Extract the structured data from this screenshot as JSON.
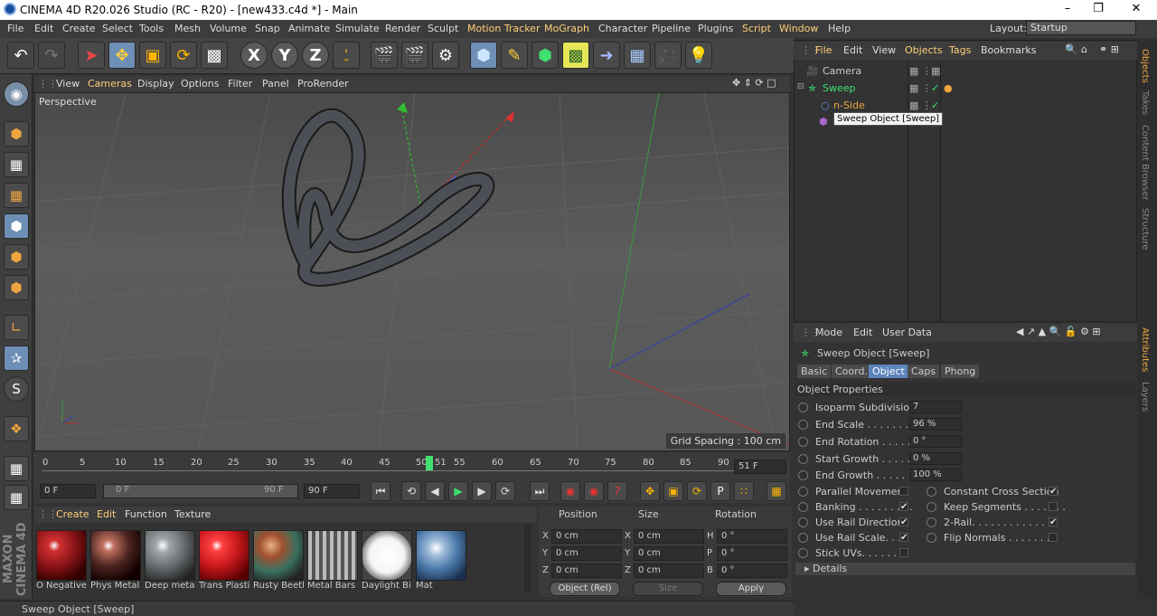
{
  "window": {
    "title": "CINEMA 4D R20.026 Studio (RC - R20) - [new433.c4d *] - Main"
  },
  "menu": [
    "File",
    "Edit",
    "Create",
    "Select",
    "Tools",
    "Mesh",
    "Volume",
    "Snap",
    "Animate",
    "Simulate",
    "Render",
    "Sculpt",
    "Motion Tracker",
    "MoGraph",
    "Character",
    "Pipeline",
    "Plugins",
    "Script",
    "Window",
    "Help"
  ],
  "layout": {
    "label": "Layout:",
    "value": "Startup"
  },
  "toolbar_glyphs": {
    "x": "X",
    "y": "Y",
    "z": "Z"
  },
  "viewport": {
    "menu": [
      "View",
      "Cameras",
      "Display",
      "Options",
      "Filter",
      "Panel",
      "ProRender"
    ],
    "label": "Perspective",
    "grid_spacing": "Grid Spacing : 100 cm"
  },
  "timeline": {
    "ticks": [
      "0",
      "5",
      "10",
      "15",
      "20",
      "25",
      "30",
      "35",
      "40",
      "45",
      "50",
      "51",
      "55",
      "60",
      "65",
      "70",
      "75",
      "80",
      "85",
      "90"
    ],
    "current_frame": "51 F",
    "start": "0 F",
    "min": "0 F",
    "max": "90 F",
    "end": "90 F"
  },
  "materials": {
    "menu": [
      "Create",
      "Edit",
      "Function",
      "Texture"
    ],
    "items": [
      {
        "name": "O Negative",
        "color": "#8a1418"
      },
      {
        "name": "Phys Metal",
        "color": "#4a2420"
      },
      {
        "name": "Deep meta",
        "color": "#6a6f72"
      },
      {
        "name": "Trans Plasti",
        "color": "#c8181c"
      },
      {
        "name": "Rusty Beetl",
        "color": "#6a5a40"
      },
      {
        "name": "Metal Bars",
        "color": "#8a8a8a"
      },
      {
        "name": "Daylight Bi",
        "color": "#e8e8e8"
      },
      {
        "name": "Mat",
        "color": "#4a78a8"
      }
    ]
  },
  "coords": {
    "headers": [
      "Position",
      "Size",
      "Rotation"
    ],
    "rows": [
      {
        "a": "X",
        "pos": "0 cm",
        "b": "X",
        "size": "0 cm",
        "c": "H",
        "rot": "0 °"
      },
      {
        "a": "Y",
        "pos": "0 cm",
        "b": "Y",
        "size": "0 cm",
        "c": "P",
        "rot": "0 °"
      },
      {
        "a": "Z",
        "pos": "0 cm",
        "b": "Z",
        "size": "0 cm",
        "c": "B",
        "rot": "0 °"
      }
    ],
    "mode": "Object (Rel)",
    "size_mode": "Size",
    "apply": "Apply"
  },
  "status": "Sweep Object [Sweep]",
  "objects": {
    "menu": [
      "File",
      "Edit",
      "View",
      "Objects",
      "Tags",
      "Bookmarks"
    ],
    "items": [
      {
        "name": "Camera"
      },
      {
        "name": "Sweep"
      },
      {
        "name": "n-Side"
      }
    ],
    "tooltip": "Sweep Object [Sweep]"
  },
  "attributes": {
    "menu": [
      "Mode",
      "Edit",
      "User Data"
    ],
    "title": "Sweep Object [Sweep]",
    "tabs": [
      "Basic",
      "Coord.",
      "Object",
      "Caps",
      "Phong"
    ],
    "section": "Object Properties",
    "fields": [
      {
        "label": "Isoparm Subdivision",
        "value": "7"
      },
      {
        "label": "End Scale . . . . . . . . .",
        "value": "96 %"
      },
      {
        "label": "End Rotation . . . . . .",
        "value": "0 °"
      },
      {
        "label": "Start Growth . . . . . .",
        "value": "0 %"
      },
      {
        "label": "End Growth . . . . . . .",
        "value": "100 %"
      }
    ],
    "checks_left": [
      {
        "label": "Parallel Movement",
        "checked": ""
      },
      {
        "label": "Banking . . . . . . . . .",
        "checked": "✔"
      },
      {
        "label": "Use Rail Direction",
        "checked": "✔"
      },
      {
        "label": "Use Rail Scale. . . .",
        "checked": "✔"
      },
      {
        "label": "Stick UVs. . . . . . . .",
        "checked": ""
      }
    ],
    "checks_right": [
      {
        "label": "Constant Cross Section",
        "checked": "✔"
      },
      {
        "label": "Keep Segments . . . . . . .",
        "checked": ""
      },
      {
        "label": "2-Rail. . . . . . . . . . . . . .",
        "checked": "✔"
      },
      {
        "label": "Flip Normals . . . . . . . .",
        "checked": ""
      }
    ],
    "details": "Details"
  },
  "right_tabs": [
    "Objects",
    "Takes",
    "Content Browser",
    "Structure",
    "Attributes",
    "Layers"
  ],
  "logo": "MAXON CINEMA 4D"
}
